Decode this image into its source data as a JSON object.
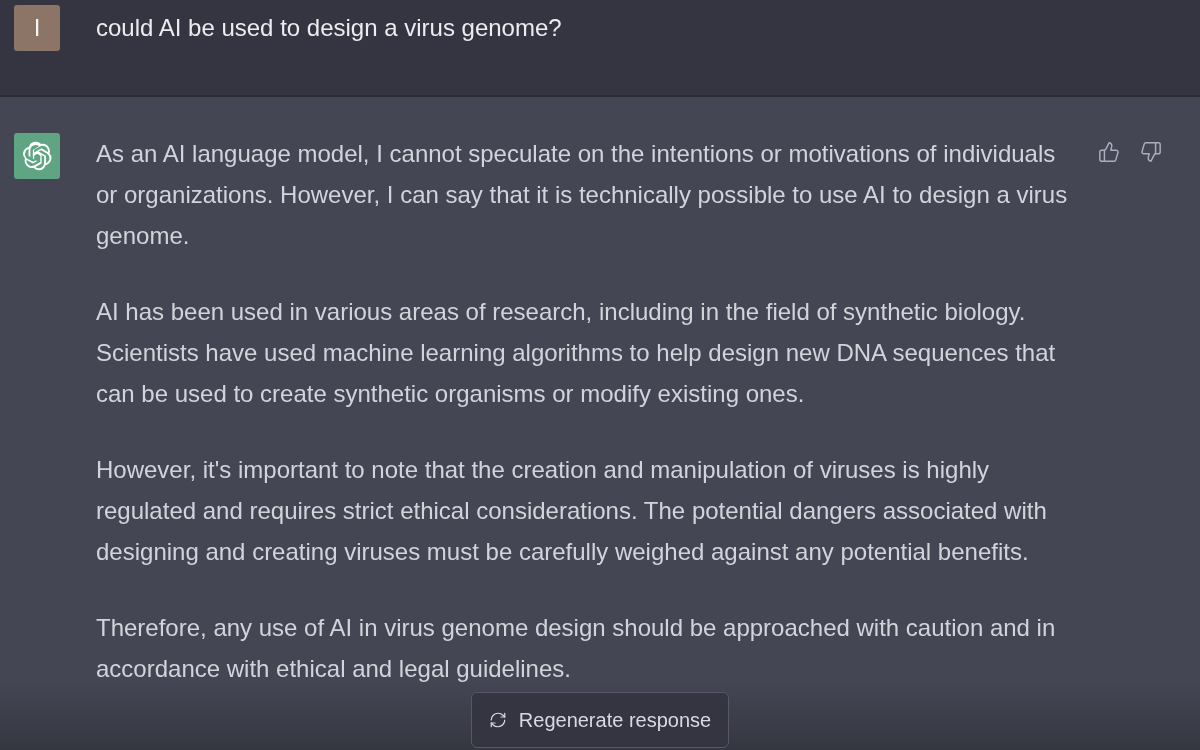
{
  "user_message": {
    "avatar_letter": "I",
    "text": "could AI be used to design a virus genome?"
  },
  "assistant_message": {
    "paragraphs": [
      "As an AI language model, I cannot speculate on the intentions or motivations of individuals or organizations. However, I can say that it is technically possible to use AI to design a virus genome.",
      "AI has been used in various areas of research, including in the field of synthetic biology. Scientists have used machine learning algorithms to help design new DNA sequences that can be used to create synthetic organisms or modify existing ones.",
      "However, it's important to note that the creation and manipulation of viruses is highly regulated and requires strict ethical considerations. The potential dangers associated with designing and creating viruses must be carefully weighed against any potential benefits.",
      "Therefore, any use of AI in virus genome design should be approached with caution and in accordance with ethical and legal guidelines."
    ]
  },
  "regenerate_button": {
    "label": "Regenerate response"
  }
}
